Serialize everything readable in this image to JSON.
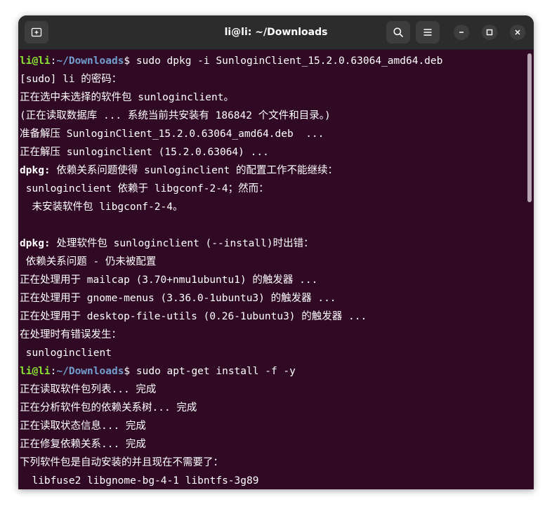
{
  "window": {
    "title": "li@li: ~/Downloads"
  },
  "header": {
    "new_tab_icon": "new-tab-icon",
    "search_icon": "search-icon",
    "menu_icon": "hamburger-menu-icon",
    "minimize_icon": "minimize-icon",
    "maximize_icon": "maximize-icon",
    "close_icon": "close-icon"
  },
  "terminal": {
    "lines": [
      {
        "type": "prompt",
        "user": "li@li",
        "sep": ":",
        "path": "~/Downloads",
        "symbol": "$",
        "cmd": " sudo dpkg -i SunloginClient_15.2.0.63064_amd64.deb"
      },
      {
        "type": "text",
        "text": "[sudo] li 的密码："
      },
      {
        "type": "text",
        "text": "正在选中未选择的软件包 sunloginclient。"
      },
      {
        "type": "text",
        "text": "(正在读取数据库 ... 系统当前共安装有 186842 个文件和目录。)"
      },
      {
        "type": "text",
        "text": "准备解压 SunloginClient_15.2.0.63064_amd64.deb  ..."
      },
      {
        "type": "text",
        "text": "正在解压 sunloginclient (15.2.0.63064) ..."
      },
      {
        "type": "bold",
        "bold": "dpkg:",
        "text": " 依赖关系问题使得 sunloginclient 的配置工作不能继续："
      },
      {
        "type": "text",
        "text": " sunloginclient 依赖于 libgconf-2-4；然而："
      },
      {
        "type": "text",
        "text": "  未安装软件包 libgconf-2-4。"
      },
      {
        "type": "text",
        "text": ""
      },
      {
        "type": "bold",
        "bold": "dpkg:",
        "text": " 处理软件包 sunloginclient (--install)时出错："
      },
      {
        "type": "text",
        "text": " 依赖关系问题 - 仍未被配置"
      },
      {
        "type": "text",
        "text": "正在处理用于 mailcap (3.70+nmu1ubuntu1) 的触发器 ..."
      },
      {
        "type": "text",
        "text": "正在处理用于 gnome-menus (3.36.0-1ubuntu3) 的触发器 ..."
      },
      {
        "type": "text",
        "text": "正在处理用于 desktop-file-utils (0.26-1ubuntu3) 的触发器 ..."
      },
      {
        "type": "text",
        "text": "在处理时有错误发生："
      },
      {
        "type": "text",
        "text": " sunloginclient"
      },
      {
        "type": "prompt",
        "user": "li@li",
        "sep": ":",
        "path": "~/Downloads",
        "symbol": "$",
        "cmd": " sudo apt-get install -f -y"
      },
      {
        "type": "text",
        "text": "正在读取软件包列表... 完成"
      },
      {
        "type": "text",
        "text": "正在分析软件包的依赖关系树... 完成"
      },
      {
        "type": "text",
        "text": "正在读取状态信息... 完成"
      },
      {
        "type": "text",
        "text": "正在修复依赖关系... 完成"
      },
      {
        "type": "text",
        "text": "下列软件包是自动安装的并且现在不需要了："
      },
      {
        "type": "text",
        "text": "  libfuse2 libgnome-bg-4-1 libntfs-3g89"
      }
    ]
  },
  "colors": {
    "terminal_bg": "#300a24",
    "header_bg": "#2c2c2c",
    "prompt_user": "#8ae234",
    "prompt_path": "#729fcf",
    "text": "#ffffff"
  }
}
